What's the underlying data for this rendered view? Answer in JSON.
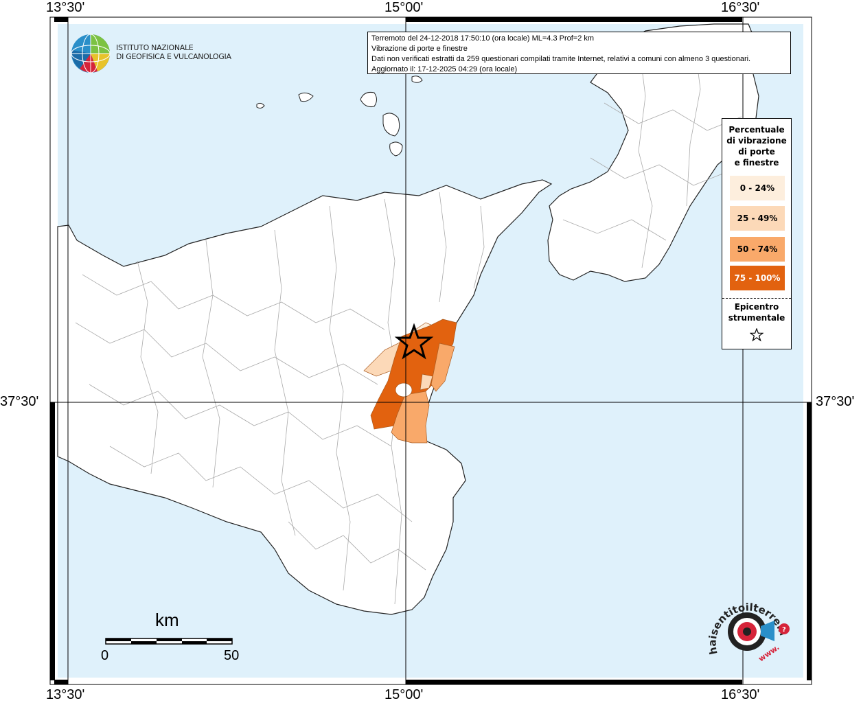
{
  "info_box": {
    "line1": "Terremoto del 24-12-2018 17:50:10 (ora locale) ML=4.3 Prof=2 km",
    "line2": "Vibrazione di porte e finestre",
    "line3": "Dati non verificati estratti da 259 questionari compilati tramite Internet, relativi a comuni con almeno 3 questionari.",
    "line4": "Aggiornato il: 17-12-2025 04:29 (ora locale)"
  },
  "axes": {
    "lon_ticks": [
      "13°30'",
      "15°00'",
      "16°30'"
    ],
    "lat_ticks": [
      "37°30'"
    ]
  },
  "legend": {
    "title": "Percentuale\ndi vibrazione\ndi porte\ne finestre",
    "classes": [
      {
        "label": "0 - 24%",
        "color": "#fdeedd"
      },
      {
        "label": "25 - 49%",
        "color": "#fcd9b8"
      },
      {
        "label": "50 - 74%",
        "color": "#f9a96a"
      },
      {
        "label": "75 - 100%",
        "color": "#e2620f"
      }
    ],
    "epicenter_label": "Epicentro\nstrumentale"
  },
  "logo_ingv": {
    "line1": "ISTITUTO NAZIONALE",
    "line2": "DI GEOFISICA E VULCANOLOGIA"
  },
  "scale_bar": {
    "unit": "km",
    "min_label": "0",
    "max_label": "50"
  },
  "logo_hst": {
    "text": "haisentitoilterremoto.it",
    "prefix": "www."
  },
  "colors": {
    "sea": "#dff1fb",
    "land": "#ffffff",
    "graticule": "#000000"
  }
}
